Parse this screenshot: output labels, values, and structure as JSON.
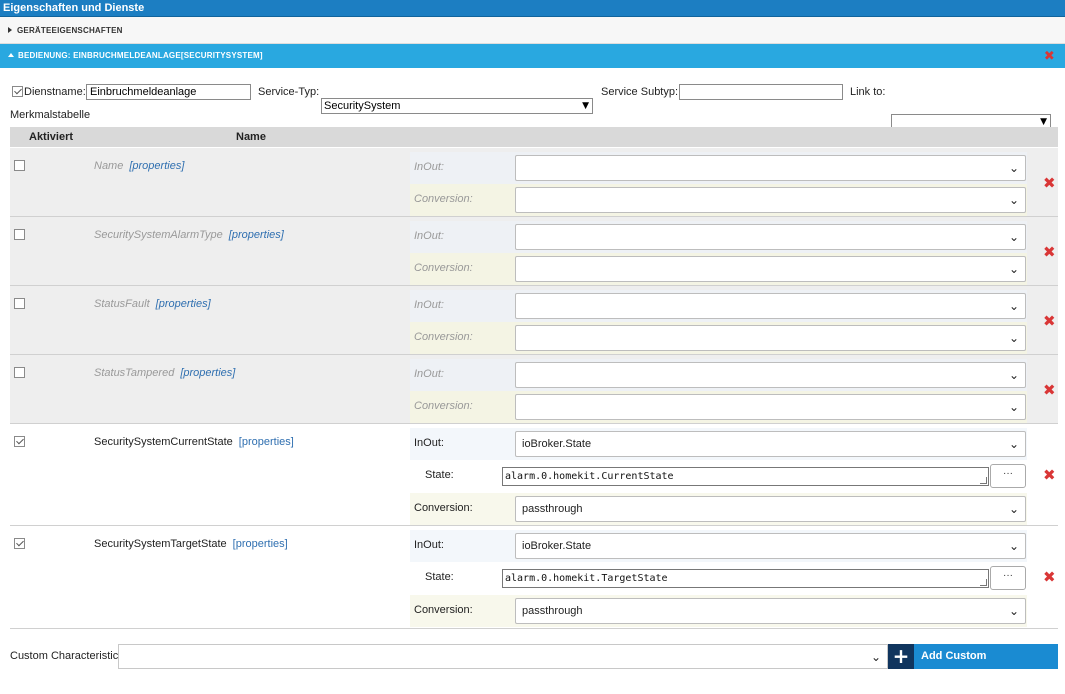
{
  "window": {
    "title": "Eigenschaften und Dienste"
  },
  "sections": {
    "device_properties": "GERÄTEEIGENSCHAFTEN",
    "service": "BEDIENUNG: EINBRUCHMELDEANLAGE[SECURITYSYSTEM]"
  },
  "service_form": {
    "dienstname_label": "Dienstname:",
    "dienstname_value": "Einbruchmeldeanlage",
    "service_typ_label": "Service-Typ:",
    "service_typ_value": "SecuritySystem",
    "service_subtyp_label": "Service Subtyp:",
    "service_subtyp_value": "",
    "link_to_label": "Link to:",
    "link_to_value": ""
  },
  "table": {
    "title": "Merkmalstabelle",
    "col_activated": "Aktiviert",
    "col_name": "Name",
    "properties_link": "[properties]",
    "inout_label": "InOut:",
    "conversion_label": "Conversion:",
    "state_label": "State:",
    "dots_label": "···",
    "rows": [
      {
        "name": "Name",
        "active": false,
        "inout": "",
        "conversion": ""
      },
      {
        "name": "SecuritySystemAlarmType",
        "active": false,
        "inout": "",
        "conversion": ""
      },
      {
        "name": "StatusFault",
        "active": false,
        "inout": "",
        "conversion": ""
      },
      {
        "name": "StatusTampered",
        "active": false,
        "inout": "",
        "conversion": ""
      },
      {
        "name": "SecuritySystemCurrentState",
        "active": true,
        "inout": "ioBroker.State",
        "state": "alarm.0.homekit.CurrentState",
        "conversion": "passthrough"
      },
      {
        "name": "SecuritySystemTargetState",
        "active": true,
        "inout": "ioBroker.State",
        "state": "alarm.0.homekit.TargetState",
        "conversion": "passthrough"
      }
    ]
  },
  "custom": {
    "label": "Custom Characteristic",
    "value": "",
    "add_button": "Add Custom Characteristic"
  },
  "icons": {
    "delete": "close-icon",
    "expand": "caret-icon",
    "add": "plus-icon"
  },
  "colors": {
    "header": "#1c7ec2",
    "section_active": "#29a8e0",
    "delete": "#d93636",
    "button": "#1a8bd2",
    "button_icon_bg": "#10355e"
  }
}
